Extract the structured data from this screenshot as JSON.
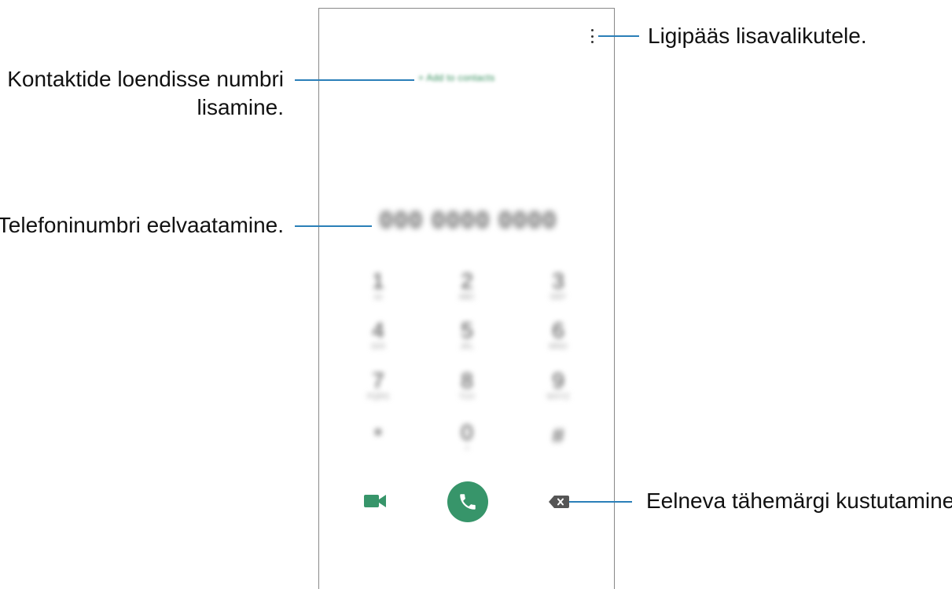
{
  "phone": {
    "add_contacts_label": "+ Add to contacts",
    "number_display": "000 0000 0000",
    "keypad": [
      {
        "digit": "1",
        "letters": "oo"
      },
      {
        "digit": "2",
        "letters": "ABC"
      },
      {
        "digit": "3",
        "letters": "DEF"
      },
      {
        "digit": "4",
        "letters": "GHI"
      },
      {
        "digit": "5",
        "letters": "JKL"
      },
      {
        "digit": "6",
        "letters": "MNO"
      },
      {
        "digit": "7",
        "letters": "PQRS"
      },
      {
        "digit": "8",
        "letters": "TUV"
      },
      {
        "digit": "9",
        "letters": "WXYZ"
      },
      {
        "digit": "*",
        "letters": ""
      },
      {
        "digit": "0",
        "letters": "+"
      },
      {
        "digit": "#",
        "letters": ""
      }
    ],
    "icons": {
      "menu": "more-options-icon",
      "video": "video-call-icon",
      "call": "phone-icon",
      "backspace": "backspace-icon"
    },
    "colors": {
      "accent": "#37956a",
      "callout": "#2a7fb8"
    }
  },
  "callouts": {
    "more_options": "Ligipääs lisavalikutele.",
    "add_contact_line1": "Kontaktide loendisse numbri",
    "add_contact_line2": "lisamine.",
    "preview_number": "Telefoninumbri eelvaatamine.",
    "delete_char": "Eelneva tähemärgi kustutamine."
  }
}
